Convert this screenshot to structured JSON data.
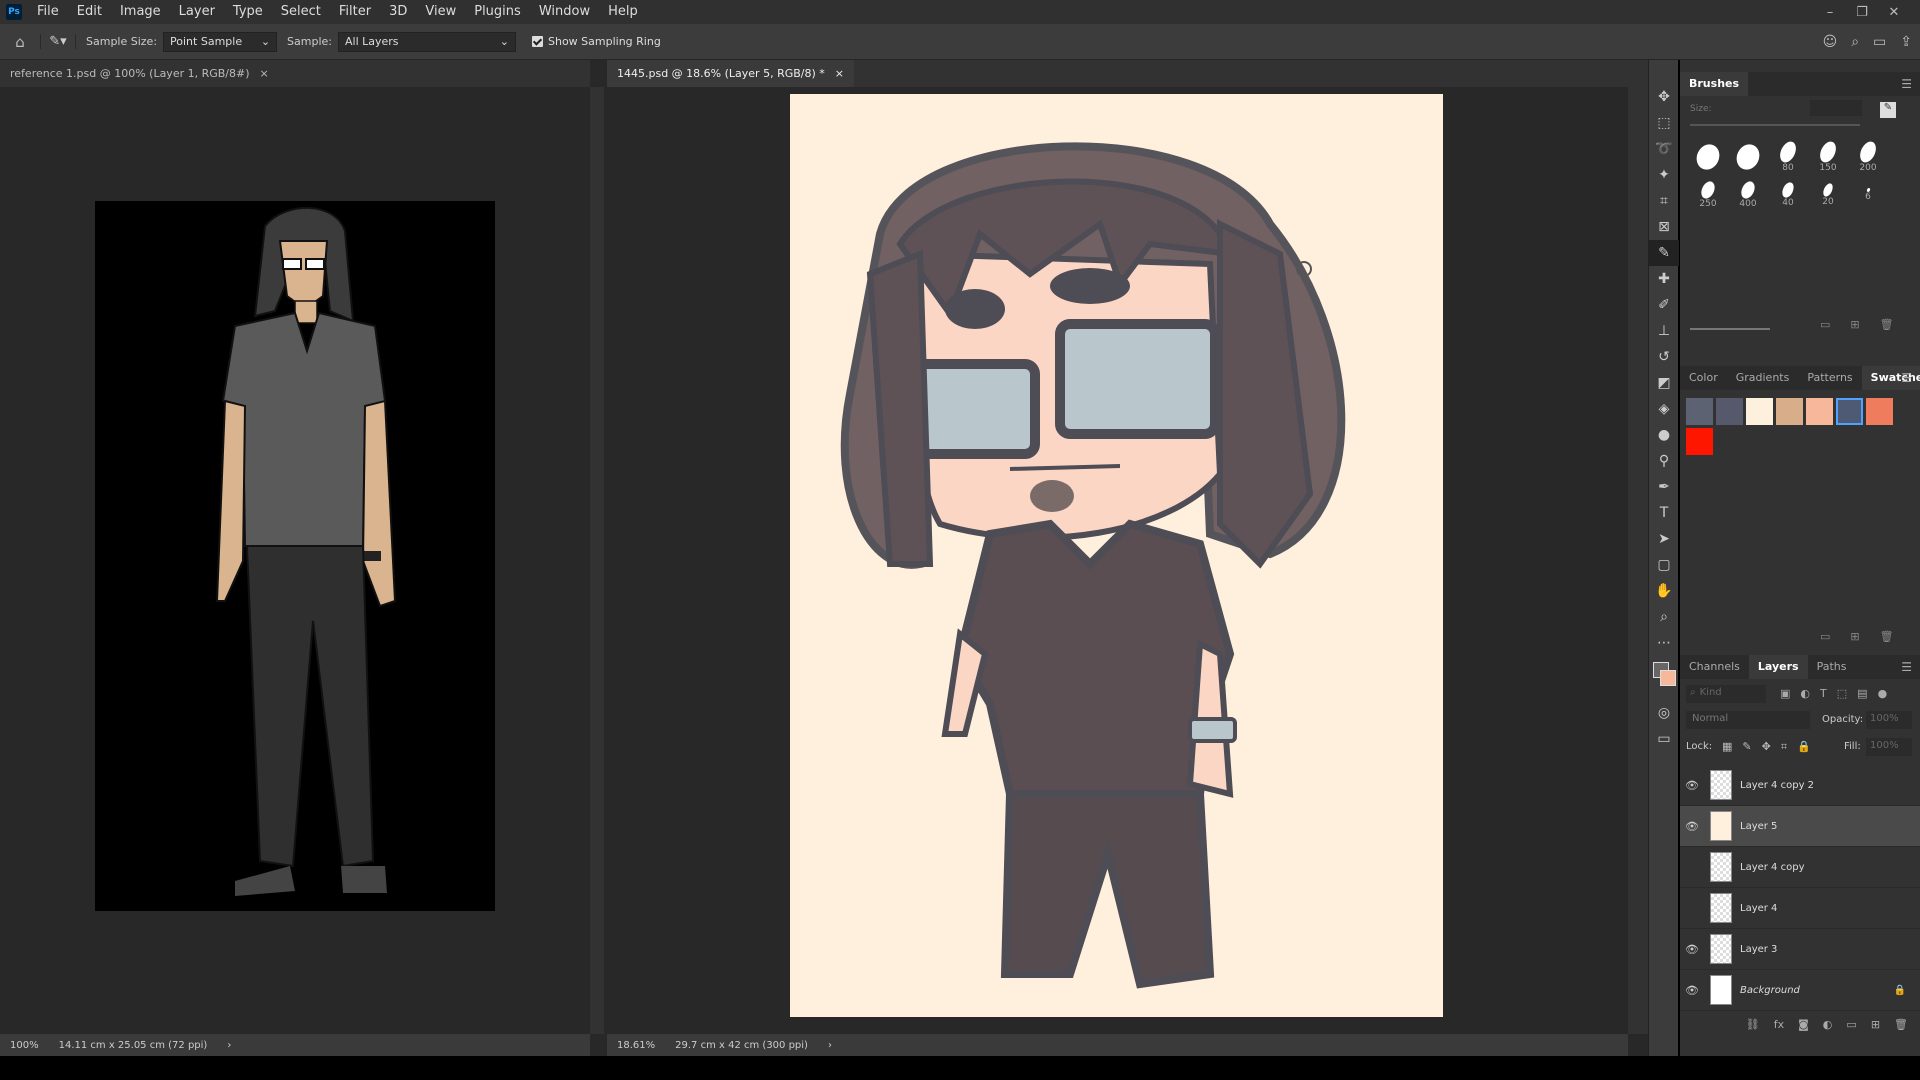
{
  "app": {
    "logo": "Ps"
  },
  "menu": [
    "File",
    "Edit",
    "Image",
    "Layer",
    "Type",
    "Select",
    "Filter",
    "3D",
    "View",
    "Plugins",
    "Window",
    "Help"
  ],
  "window_controls": {
    "minimize": "–",
    "restore": "❐",
    "close": "✕"
  },
  "options": {
    "sample_size_label": "Sample Size:",
    "sample_size_value": "Point Sample",
    "sample_label": "Sample:",
    "sample_value": "All Layers",
    "show_ring_label": "Show Sampling Ring"
  },
  "documents": [
    {
      "title": "reference 1.psd @ 100% (Layer 1, RGB/8#)",
      "zoom": "100%",
      "size": "14.11 cm x 25.05 cm (72 ppi)"
    },
    {
      "title": "1445.psd @ 18.6% (Layer 5, RGB/8) *",
      "zoom": "18.61%",
      "size": "29.7 cm x 42 cm (300 ppi)"
    }
  ],
  "brushes": {
    "tab": "Brushes",
    "size_label": "Size:",
    "presets": [
      "",
      "",
      "80",
      "150",
      "200",
      "250",
      "400",
      "40",
      "20",
      "6"
    ]
  },
  "color_tabs": [
    "Color",
    "Gradients",
    "Patterns",
    "Swatches"
  ],
  "swatches": [
    "#5d6273",
    "#55596b",
    "#fdf0dc",
    "#d8ad8a",
    "#f7b79b",
    "#4e5a73",
    "#f07c5e",
    "#ff1600"
  ],
  "layer_tabs": [
    "Channels",
    "Layers",
    "Paths"
  ],
  "layer_controls": {
    "kind_placeholder": "Kind",
    "blend_mode": "Normal",
    "opacity_label": "Opacity:",
    "opacity_value": "100%",
    "lock_label": "Lock:",
    "fill_label": "Fill:",
    "fill_value": "100%"
  },
  "layers": [
    {
      "name": "Layer 4 copy 2",
      "visible": true
    },
    {
      "name": "Layer 5",
      "visible": true,
      "selected": true
    },
    {
      "name": "Layer 4 copy",
      "visible": false
    },
    {
      "name": "Layer 4",
      "visible": false
    },
    {
      "name": "Layer 3",
      "visible": true
    },
    {
      "name": "Background",
      "visible": true,
      "locked": true
    }
  ]
}
